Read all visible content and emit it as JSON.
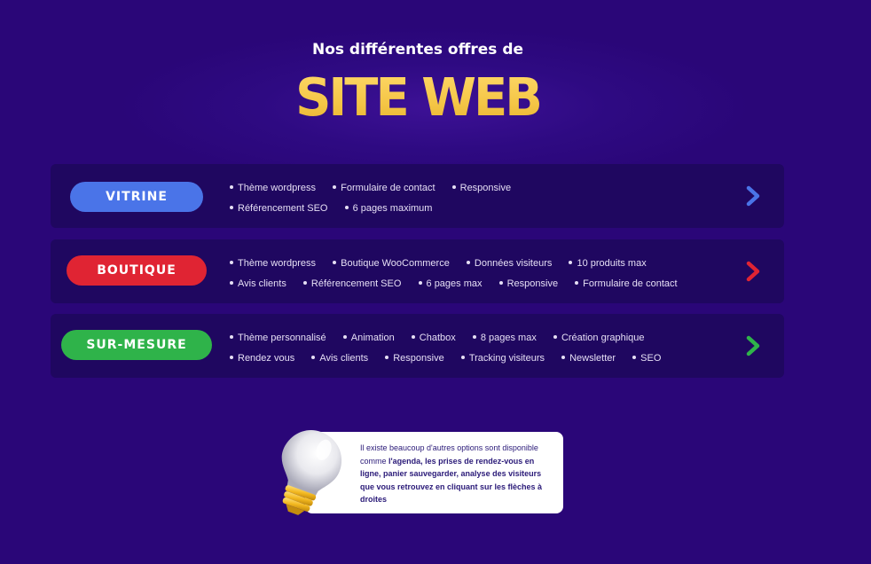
{
  "header": {
    "subtitle": "Nos différentes offres de",
    "title": "SITE WEB"
  },
  "offers": [
    {
      "name": "VITRINE",
      "color": "#4a74e8",
      "rows": [
        [
          "Thème wordpress",
          "Formulaire de contact",
          "Responsive"
        ],
        [
          "Référencement SEO",
          "6 pages maximum"
        ]
      ]
    },
    {
      "name": "BOUTIQUE",
      "color": "#e02433",
      "rows": [
        [
          "Thème wordpress",
          "Boutique WooCommerce",
          "Données visiteurs",
          "10 produits max"
        ],
        [
          "Avis clients",
          "Référencement SEO",
          "6 pages max",
          "Responsive",
          "Formulaire de contact"
        ]
      ]
    },
    {
      "name": "SUR-MESURE",
      "color": "#2fb34a",
      "rows": [
        [
          "Thème personnalisé",
          "Animation",
          "Chatbox",
          "8 pages max",
          "Création graphique"
        ],
        [
          "Rendez vous",
          "Avis clients",
          "Responsive",
          "Tracking visiteurs",
          "Newsletter",
          "SEO"
        ]
      ]
    }
  ],
  "arrows": {
    "icon": "chevron-right-icon"
  },
  "tip": {
    "text_normal": "Il existe beaucoup d'autres options sont disponible comme ",
    "text_bold": "l'agenda, les prises de rendez-vous en ligne, panier sauvegarder, analyse des visiteurs que vous retrouvez en cliquant sur les flèches à droites",
    "icon": "lightbulb-icon"
  }
}
